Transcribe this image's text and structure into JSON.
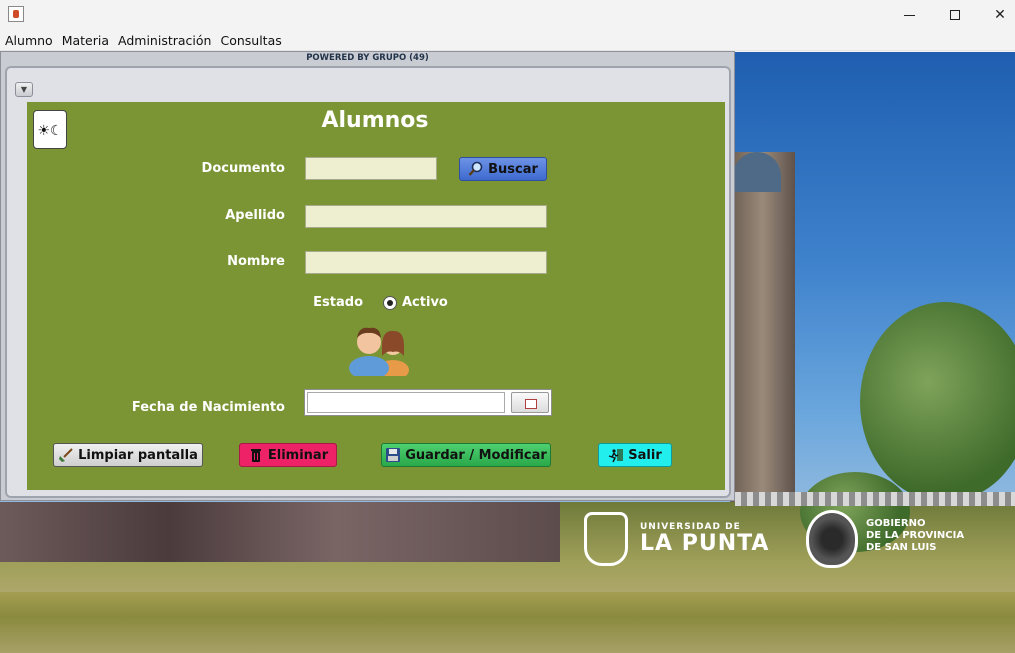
{
  "window": {
    "app_icon": "java-cup-icon",
    "controls": {
      "minimize": "minimize-icon",
      "maximize": "maximize-icon",
      "close": "close-icon",
      "close_glyph": "✕"
    }
  },
  "menubar": {
    "items": [
      "Alumno",
      "Materia",
      "Administración",
      "Consultas"
    ]
  },
  "frame": {
    "powered_by": "POWERED BY GRUPO (49)",
    "collapse_glyph": "▼",
    "theme_glyph": "☀☾"
  },
  "form": {
    "title": "Alumnos",
    "documento_label": "Documento",
    "documento_value": "",
    "buscar_label": "Buscar",
    "apellido_label": "Apellido",
    "apellido_value": "",
    "nombre_label": "Nombre",
    "nombre_value": "",
    "estado_label": "Estado",
    "activo_label": "Activo",
    "activo_checked": true,
    "fecha_label": "Fecha de Nacimiento",
    "fecha_value": ""
  },
  "actions": {
    "limpiar": "Limpiar pantalla",
    "eliminar": "Eliminar",
    "guardar": "Guardar / Modificar",
    "salir": "Salir"
  },
  "colors": {
    "panel": "#7b9535",
    "buscar": "#4a78d8",
    "limpiar": "#d9d9d9",
    "eliminar": "#ee2266",
    "guardar": "#33bb55",
    "salir": "#22eeee"
  },
  "background": {
    "university": {
      "line1": "UNIVERSIDAD DE",
      "line2": "LA PUNTA"
    },
    "gobierno": {
      "line1": "GOBIERNO",
      "line2": "DE LA PROVINCIA",
      "line3": "DE SAN LUIS"
    }
  }
}
